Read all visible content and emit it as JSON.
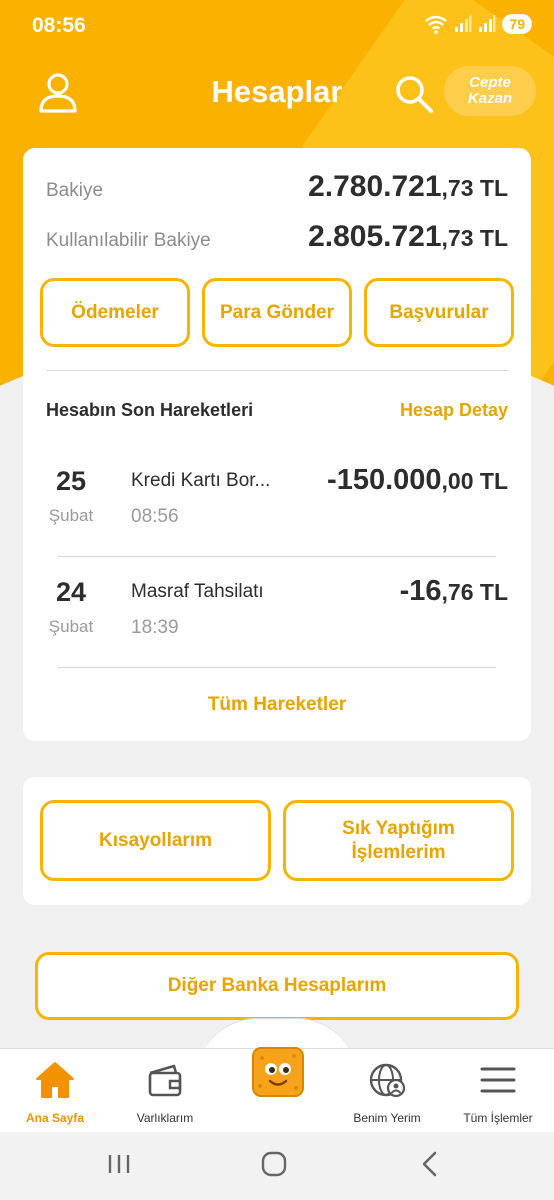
{
  "status_bar": {
    "time": "08:56",
    "battery": "79"
  },
  "header": {
    "title": "Hesaplar",
    "promo_line1": "Cepte",
    "promo_line2": "Kazan"
  },
  "balance": {
    "label": "Bakiye",
    "main": "2.780.721",
    "frac": ",73 TL",
    "available_label": "Kullanılabilir Bakiye",
    "available_main": "2.805.721",
    "available_frac": ",73 TL"
  },
  "actions": [
    "Ödemeler",
    "Para Gönder",
    "Başvurular"
  ],
  "transactions_section": {
    "title": "Hesabın Son Hareketleri",
    "detail_link": "Hesap Detay",
    "items": [
      {
        "day": "25",
        "month": "Şubat",
        "description": "Kredi Kartı Bor...",
        "time": "08:56",
        "amount_main": "-150.000",
        "amount_frac": ",00 TL"
      },
      {
        "day": "24",
        "month": "Şubat",
        "description": "Masraf Tahsilatı",
        "time": "18:39",
        "amount_main": "-16",
        "amount_frac": ",76 TL"
      }
    ],
    "all_link": "Tüm Hareketler"
  },
  "shortcuts": {
    "left": "Kısayollarım",
    "right_line1": "Sık Yaptığım",
    "right_line2": "İşlemlerim"
  },
  "other_banks": "Diğer Banka Hesaplarım",
  "bottom_nav": [
    {
      "label": "Ana Sayfa",
      "icon": "home-icon",
      "active": true
    },
    {
      "label": "Varlıklarım",
      "icon": "wallet-icon",
      "active": false
    },
    {
      "label": "Benim Yerim",
      "icon": "globe-user-icon",
      "active": false
    },
    {
      "label": "Tüm İşlemler",
      "icon": "menu-icon",
      "active": false
    }
  ],
  "colors": {
    "brand": "#fbb100",
    "accent_text": "#e8a400",
    "active_nav": "#f29200"
  }
}
